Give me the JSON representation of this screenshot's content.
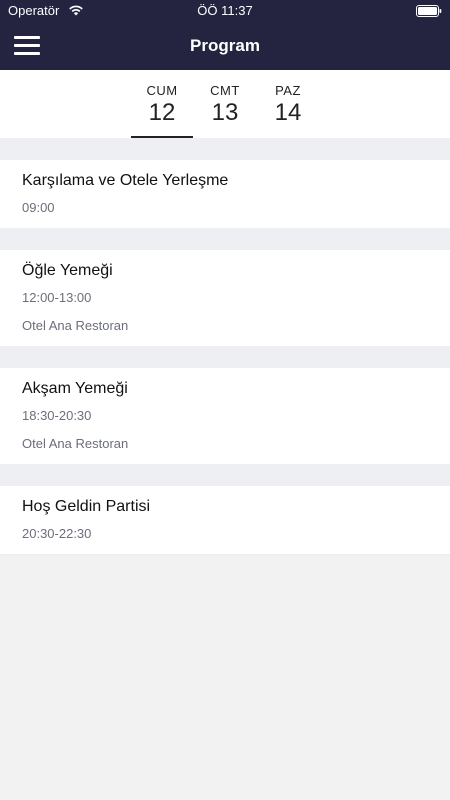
{
  "status_bar": {
    "carrier": "Operatör",
    "time": "ÖÖ 11:37"
  },
  "header": {
    "title": "Program",
    "menu_icon": "hamburger-icon"
  },
  "days": [
    {
      "name": "CUM",
      "number": "12",
      "selected": true
    },
    {
      "name": "CMT",
      "number": "13",
      "selected": false
    },
    {
      "name": "PAZ",
      "number": "14",
      "selected": false
    }
  ],
  "events": [
    {
      "title": "Karşılama ve Otele Yerleşme",
      "time": "09:00"
    },
    {
      "title": "Öğle Yemeği",
      "time": "12:00-13:00",
      "location": "Otel Ana Restoran"
    },
    {
      "title": "Akşam Yemeği",
      "time": "18:30-20:30",
      "location": "Otel Ana Restoran"
    },
    {
      "title": "Hoş Geldin Partisi",
      "time": "20:30-22:30"
    }
  ],
  "colors": {
    "header_bg": "#242440",
    "separator_bg": "#eeeff3",
    "secondary_text": "#6b6f7a"
  }
}
